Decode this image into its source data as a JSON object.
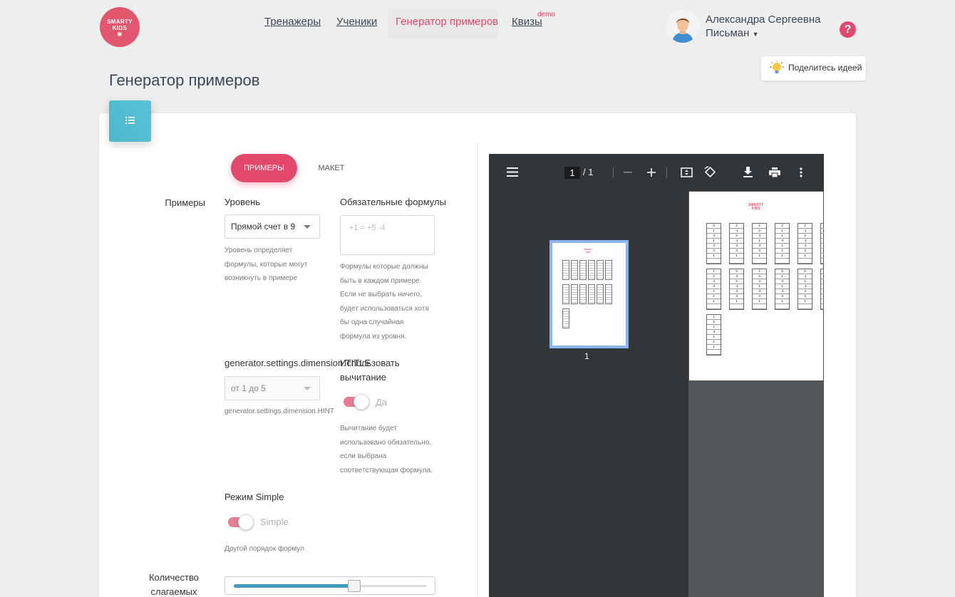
{
  "header": {
    "logo_line1": "SMARTY",
    "logo_line2": "KIDS",
    "nav": [
      "Тренажеры",
      "Ученики",
      "Генератор примеров",
      "Квизы"
    ],
    "nav_badge": "demo",
    "user_first": "Александра Сергеевна",
    "user_last": "Письман",
    "idea_label": "Поделитесь идеей"
  },
  "page": {
    "title": "Генератор примеров"
  },
  "tabs": {
    "examples": "Примеры",
    "layout": "Макет"
  },
  "form": {
    "section_label": "Примеры",
    "level_title": "Уровень",
    "level_value": "Прямой счет в 9",
    "level_hint": "Уровень определяет формулы, которые могут возникнуть в примере",
    "formulas_title": "Обязательные формулы",
    "formulas_placeholder": "+1 = +5 -4",
    "formulas_hint": "Формулы которые должны быть в каждом примере. Если не выбрать ничего, будет использоваться хотя бы одна случайная формула из уровня.",
    "dimension_title": "generator.settings.dimension.TITLE",
    "dimension_value": "от 1 до 5",
    "dimension_hint": "generator.settings.dimension.HINT",
    "subtraction_title": "Использовать вычитание",
    "subtraction_toggle": "Да",
    "subtraction_hint": "Вычитание будет использовано обязательно, если выбрана соответствующая формула.",
    "simple_title": "Режим Simple",
    "simple_toggle": "Simple",
    "simple_hint": "Другой порядок формул",
    "addends_label": "Количество слагаемых",
    "addends_fraction": 0.6
  },
  "pdf": {
    "page_current": "1",
    "page_total": "/ 1",
    "thumb_label": "1",
    "mini_logo_1": "SMARTY",
    "mini_logo_2": "KIDS",
    "tables_row1": [
      [
        "3",
        "1",
        "-2",
        "1",
        "-2",
        "3",
        "1"
      ],
      [
        "2",
        "-1",
        "3",
        "-1",
        "-2",
        "3",
        "1"
      ],
      [
        "1",
        "3",
        "-2",
        "1",
        "-2",
        "3",
        "1"
      ],
      [
        "2",
        "1",
        "1",
        "-3",
        "1",
        "2",
        "1"
      ],
      [
        "2",
        "-1",
        "3",
        "-1",
        "-2",
        "3",
        "1"
      ],
      [
        "1",
        "2",
        "1",
        "-2",
        "-1",
        "3",
        "1"
      ]
    ],
    "tables_row2": [
      [
        "1",
        "3",
        "-1",
        "-2",
        "1",
        "2",
        "1"
      ],
      [
        "3",
        "-2",
        "3",
        "-1",
        "-2",
        "3",
        "1"
      ],
      [
        "1",
        "3",
        "-2",
        "1",
        "-2",
        "3",
        "1"
      ],
      [
        "3",
        "1",
        "-2",
        "1",
        "-2",
        "3",
        "1"
      ],
      [
        "3",
        "-1",
        "2",
        "-1",
        "-2",
        "3",
        "1"
      ],
      [
        "3",
        "1",
        "-3",
        "2",
        "-1",
        "2",
        "1"
      ]
    ],
    "table_row3": [
      "1",
      "2",
      "1",
      "-3",
      "1",
      "2",
      "1"
    ]
  }
}
